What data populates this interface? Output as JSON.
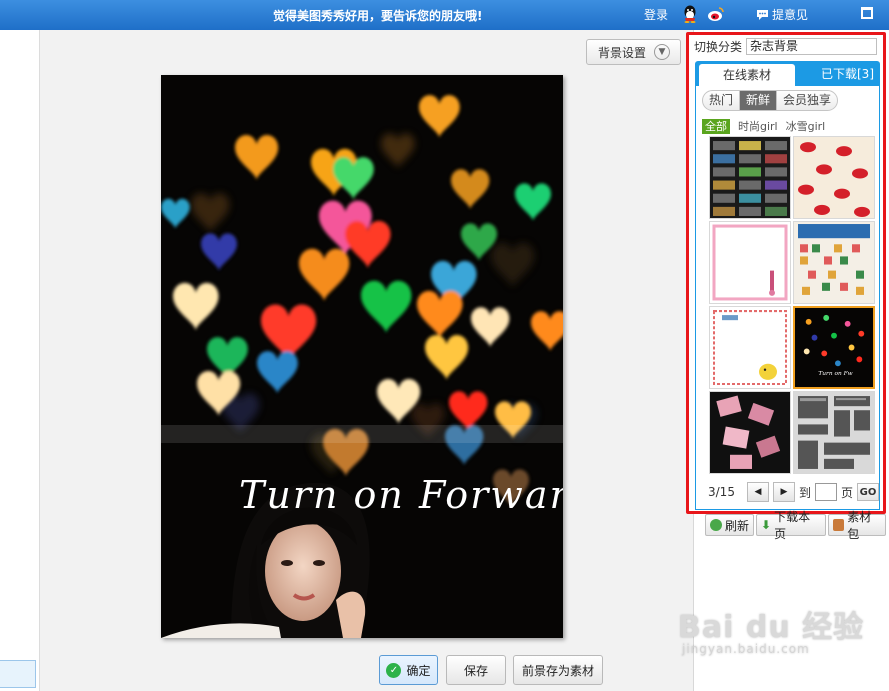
{
  "topbar": {
    "slogan": "觉得美图秀秀好用，要告诉您的朋友哦!",
    "login": "登录",
    "feedback": "提意见",
    "icons": [
      "qq-icon",
      "weibo-icon",
      "chat-icon",
      "window-icon"
    ]
  },
  "canvas": {
    "bg_settings_label": "背景设置",
    "photo_script_text": "Turn on Forward"
  },
  "actions": {
    "confirm_label": "确定",
    "save_label": "保存",
    "save_foreground_label": "前景存为素材"
  },
  "panel": {
    "category_label": "切换分类",
    "category_value": "杂志背景",
    "tab_online": "在线素材",
    "tab_downloaded": "已下载[3]",
    "segments": [
      "热门",
      "新鲜",
      "会员独享"
    ],
    "active_segment": "新鲜",
    "filters": [
      "全部",
      "时尚girl",
      "冰雪girl"
    ],
    "active_filter": "全部",
    "thumbnails": [
      {
        "name": "thumb-cassettes"
      },
      {
        "name": "thumb-lips"
      },
      {
        "name": "thumb-pink-frame"
      },
      {
        "name": "thumb-lesportsac"
      },
      {
        "name": "thumb-chick-frame"
      },
      {
        "name": "thumb-hearts",
        "selected": true
      },
      {
        "name": "thumb-cosmetics"
      },
      {
        "name": "thumb-newspaper"
      }
    ],
    "pager": {
      "status": "3/15",
      "goto_label": "到",
      "page_unit": "页",
      "go_label": "GO"
    },
    "refresh_label": "刷新",
    "download_page_label": "下载本页",
    "package_label": "素材包"
  },
  "watermark": {
    "brand": "Bai du 经验",
    "url": "jingyan.baidu.com"
  },
  "colors": {
    "topbar": "#2a7bd4",
    "highlight_box": "#e8161a",
    "tab_blue": "#1c9ae4",
    "filter_green": "#5aa51e",
    "selected_thumb": "#f0a020"
  }
}
